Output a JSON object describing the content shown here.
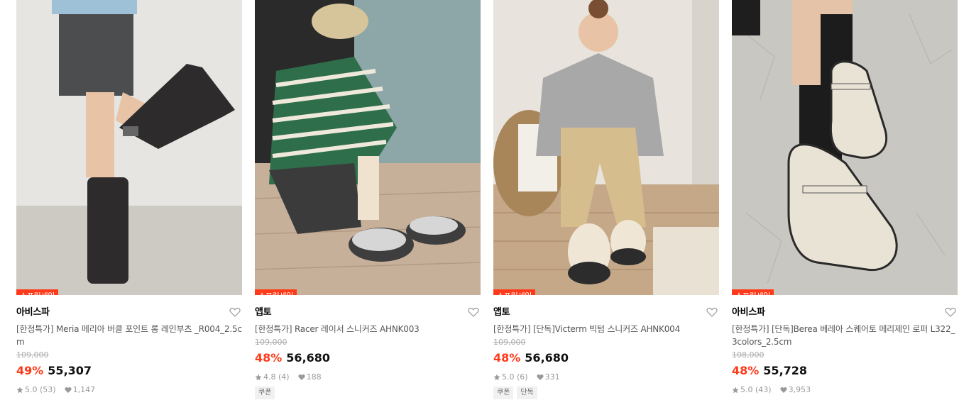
{
  "products": [
    {
      "badge": "스프링세일",
      "brand": "아비스파",
      "title": "[한정특가] Meria 메리아 버클 포인트 롱 레인부츠 _R004_2.5cm",
      "original_price": "109,000",
      "discount": "49%",
      "price": "55,307",
      "rating": "5.0 (53)",
      "likes": "1,147",
      "tags": [],
      "image": "woman-in-black-rain-boots"
    },
    {
      "badge": "스프링세일",
      "brand": "앱토",
      "title": "[한정특가] Racer 레이서 스니커즈 AHNK003",
      "original_price": "109,000",
      "discount": "48%",
      "price": "56,680",
      "rating": "4.8 (4)",
      "likes": "188",
      "tags": [
        "쿠폰"
      ],
      "image": "woman-tying-sneakers"
    },
    {
      "badge": "스프링세일",
      "brand": "앱토",
      "title": "[한정특가] [단독]Victerm 빅텀 스니커즈 AHNK004",
      "original_price": "109,000",
      "discount": "48%",
      "price": "56,680",
      "rating": "5.0 (6)",
      "likes": "331",
      "tags": [
        "쿠폰",
        "단독"
      ],
      "image": "woman-sitting-with-sneakers"
    },
    {
      "badge": "스프링세일",
      "brand": "아비스파",
      "title": "[한정특가] [단독]Berea 베레아 스퀘어토 메리제인 로퍼 L322_3colors_2.5cm",
      "original_price": "108,000",
      "discount": "48%",
      "price": "55,728",
      "rating": "5.0 (43)",
      "likes": "3,953",
      "tags": [],
      "image": "cream-mary-jane-loafers"
    }
  ],
  "colors": {
    "accent": "#ff3a1a",
    "price": "#111111",
    "muted": "#999999"
  }
}
